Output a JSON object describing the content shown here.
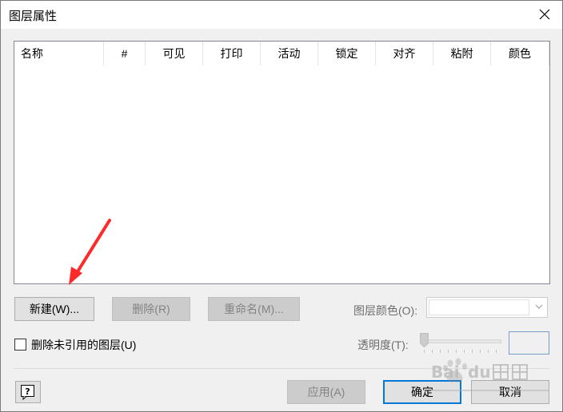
{
  "window": {
    "title": "图层属性"
  },
  "layers_table": {
    "columns": [
      "名称",
      "#",
      "可见",
      "打印",
      "活动",
      "锁定",
      "对齐",
      "粘附",
      "颜色"
    ],
    "rows": []
  },
  "buttons": {
    "new_label": "新建(W)...",
    "delete_label": "删除(R)",
    "rename_label": "重命名(M)...",
    "apply_label": "应用(A)",
    "ok_label": "确定",
    "cancel_label": "取消"
  },
  "layer_color": {
    "label": "图层颜色(O):",
    "value": ""
  },
  "remove_unreferenced": {
    "label": "删除未引用的图层(U)",
    "checked": false
  },
  "transparency": {
    "label": "透明度(T):",
    "value": 0,
    "text": ""
  },
  "icons": {
    "close": "close-icon",
    "help": "help-icon",
    "dropdown": "chevron-down-icon"
  },
  "colors": {
    "default_button_border": "#0078d7",
    "annotation_arrow": "#ff2a2a"
  }
}
